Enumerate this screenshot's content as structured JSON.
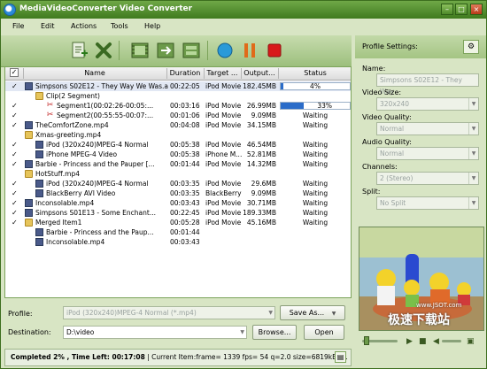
{
  "window": {
    "title": "MediaVideoConverter Video Converter",
    "min": "–",
    "max": "□",
    "close": "×"
  },
  "menu": [
    "File",
    "Edit",
    "Actions",
    "Tools",
    "Help"
  ],
  "grid": {
    "headers": {
      "name": "Name",
      "duration": "Duration",
      "target": "Target ...",
      "output": "Output...",
      "status": "Status"
    },
    "rows": [
      {
        "name": "Simpsons S02E12 - They Way We Was.avi",
        "duration": "00:22:05",
        "target": "iPod Movie",
        "output": "182.45MB",
        "status": "4%",
        "progress": 4,
        "checked": true,
        "kind": "film",
        "indent": 0
      },
      {
        "name": "Clip(2 Segment)",
        "duration": "",
        "target": "",
        "output": "",
        "status": "",
        "checked": false,
        "kind": "folder",
        "indent": 1
      },
      {
        "name": "Segment1(00:02:26-00:05:...",
        "duration": "00:03:16",
        "target": "iPod Movie",
        "output": "26.99MB",
        "status": "33%",
        "progress": 33,
        "checked": true,
        "kind": "scissors",
        "indent": 2
      },
      {
        "name": "Segment2(00:55:55-00:07:...",
        "duration": "00:01:06",
        "target": "iPod Movie",
        "output": "9.09MB",
        "status": "Waiting",
        "checked": true,
        "kind": "scissors",
        "indent": 2
      },
      {
        "name": "TheComfortZone.mp4",
        "duration": "00:04:08",
        "target": "iPod Movie",
        "output": "34.15MB",
        "status": "Waiting",
        "checked": true,
        "kind": "film",
        "indent": 0
      },
      {
        "name": "Xmas-greeting.mp4",
        "duration": "",
        "target": "",
        "output": "",
        "status": "",
        "checked": false,
        "kind": "folder",
        "indent": 0
      },
      {
        "name": "iPod (320x240)MPEG-4 Normal",
        "duration": "00:05:38",
        "target": "iPod Movie",
        "output": "46.54MB",
        "status": "Waiting",
        "checked": true,
        "kind": "film",
        "indent": 1
      },
      {
        "name": "iPhone MPEG-4 Video",
        "duration": "00:05:38",
        "target": "iPhone M...",
        "output": "52.81MB",
        "status": "Waiting",
        "checked": true,
        "kind": "film",
        "indent": 1
      },
      {
        "name": "Barbie - Princess and the Pauper [...",
        "duration": "00:01:44",
        "target": "iPod Movie",
        "output": "14.32MB",
        "status": "Waiting",
        "checked": true,
        "kind": "film",
        "indent": 0
      },
      {
        "name": "HotStuff.mp4",
        "duration": "",
        "target": "",
        "output": "",
        "status": "",
        "checked": false,
        "kind": "folder",
        "indent": 0
      },
      {
        "name": "iPod (320x240)MPEG-4 Normal",
        "duration": "00:03:35",
        "target": "iPod Movie",
        "output": "29.6MB",
        "status": "Waiting",
        "checked": true,
        "kind": "film",
        "indent": 1
      },
      {
        "name": "BlackBerry AVI Video",
        "duration": "00:03:35",
        "target": "BlackBerry",
        "output": "9.09MB",
        "status": "Waiting",
        "checked": true,
        "kind": "film",
        "indent": 1
      },
      {
        "name": "Inconsolable.mp4",
        "duration": "00:03:43",
        "target": "iPod Movie",
        "output": "30.71MB",
        "status": "Waiting",
        "checked": true,
        "kind": "film",
        "indent": 0
      },
      {
        "name": "Simpsons S01E13 - Some Enchant...",
        "duration": "00:22:45",
        "target": "iPod Movie",
        "output": "189.33MB",
        "status": "Waiting",
        "checked": true,
        "kind": "film",
        "indent": 0
      },
      {
        "name": "Merged Item1",
        "duration": "00:05:28",
        "target": "iPod Movie",
        "output": "45.16MB",
        "status": "Waiting",
        "checked": true,
        "kind": "folder",
        "indent": 0
      },
      {
        "name": "Barbie - Princess and the Paup...",
        "duration": "00:01:44",
        "target": "",
        "output": "",
        "status": "",
        "checked": false,
        "kind": "film",
        "indent": 1
      },
      {
        "name": "Inconsolable.mp4",
        "duration": "00:03:43",
        "target": "",
        "output": "",
        "status": "",
        "checked": false,
        "kind": "film",
        "indent": 1
      }
    ]
  },
  "bottom": {
    "profile_label": "Profile:",
    "profile_value": "iPod (320x240)MPEG-4 Normal (*.mp4)",
    "save_as": "Save As...",
    "destination_label": "Destination:",
    "destination_value": "D:\\video",
    "browse": "Browse...",
    "open": "Open"
  },
  "status": {
    "bold": "Completed 2% , Time Left: 00:17:08",
    "detail": " | Current Item:frame= 1339 fps= 54 q=2.0 size=6819kB t..."
  },
  "settings": {
    "title": "Profile Settings:",
    "name_label": "Name:",
    "name_value": "Simpsons S02E12 - They Way",
    "size_label": "Video Size:",
    "size_value": "320x240",
    "vq_label": "Video Quality:",
    "vq_value": "Normal",
    "aq_label": "Audio Quality:",
    "aq_value": "Normal",
    "ch_label": "Channels:",
    "ch_value": "2 (Stereo)",
    "split_label": "Split:",
    "split_value": "No Split"
  },
  "watermark": {
    "line1": "极速下载站",
    "line2": "www.JSOT.com"
  },
  "colors": {
    "accent_green": "#3f7a1e",
    "progress_blue": "#2a6cc9",
    "panel": "#d8e5c4"
  }
}
